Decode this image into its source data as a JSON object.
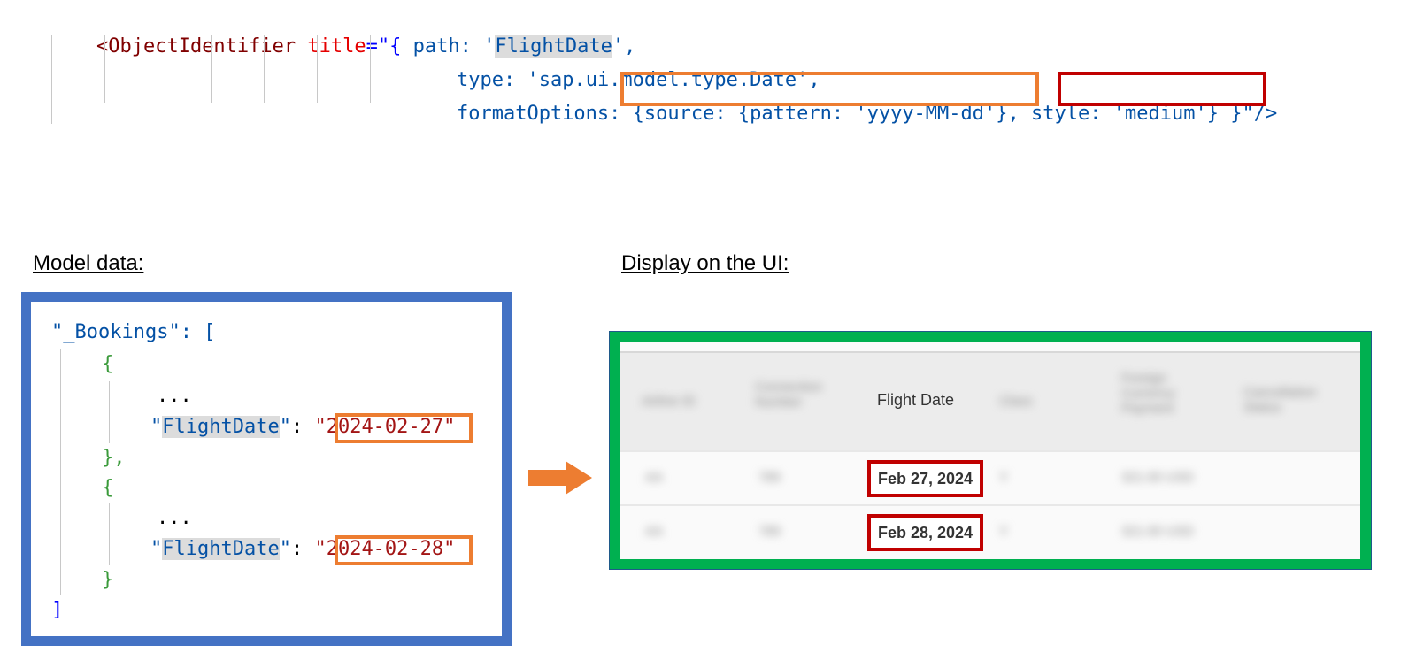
{
  "code": {
    "line1": {
      "tag": "<ObjectIdentifier",
      "attr": "title",
      "open": "=\"{",
      "path_key": "path:",
      "path_q1": "'",
      "path_val": "FlightDate",
      "path_q2": "',"
    },
    "line2": {
      "key": "type:",
      "val": "'sap.ui.model.type.Date',"
    },
    "line3": {
      "key": "formatOptions:",
      "brace_open": "{",
      "source": "source: {pattern: 'yyyy-MM-dd'}",
      "comma": ",",
      "style": "style: 'medium'",
      "close": "} }\"/>"
    }
  },
  "labels": {
    "model_heading": "Model data:",
    "ui_heading": "Display on the UI:"
  },
  "model": {
    "root_key": "\"_Bookings\": [",
    "open1": "{",
    "dots1": "...",
    "field_key": "\"FlightDate\"",
    "colon": ": ",
    "value1": "2024-02-27",
    "close1": "},",
    "open2": "{",
    "dots2": "...",
    "value2": "2024-02-28",
    "close2": "}",
    "end": "]"
  },
  "ui": {
    "column_header": "Flight Date",
    "rows": [
      "Feb 27, 2024",
      "Feb 28, 2024"
    ],
    "blurred_headers": [
      "Airline ID",
      "Connection Number",
      "Class",
      "Foreign Currency Payment",
      "Cancellation Status"
    ],
    "blurred_cells": [
      "AA",
      "789",
      "Y",
      "321.00 USD"
    ]
  },
  "colors": {
    "model_border": "#4472c4",
    "ui_border": "#00b050",
    "source_highlight": "#ed7d31",
    "style_highlight": "#c00000",
    "arrow": "#ed7d31"
  }
}
